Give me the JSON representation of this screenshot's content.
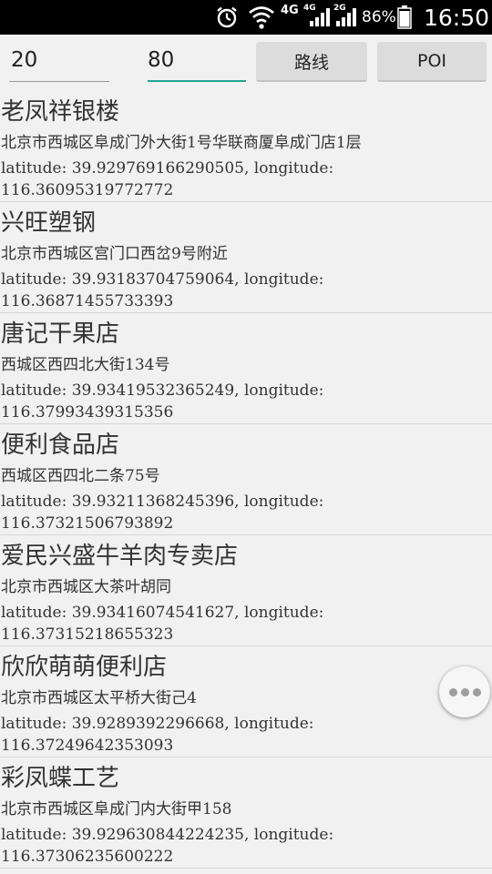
{
  "status_bar": {
    "network_4g": "4G",
    "network_4g_small": "4G",
    "network_2g_small": "2G",
    "battery_percent": "86%",
    "time": "16:50",
    "icons": [
      "alarm-icon",
      "wifi-icon",
      "signal-icon",
      "battery-icon"
    ]
  },
  "toolbar": {
    "input_1_value": "20",
    "input_2_value": "80",
    "route_button_label": "路线",
    "poi_button_label": "POI",
    "accent_color": "#24a396"
  },
  "poi_list": [
    {
      "name": "老凤祥银楼",
      "address": "北京市西城区阜成门外大街1号华联商厦阜成门店1层",
      "coords": "latitude: 39.929769166290505, longitude: 116.36095319772772"
    },
    {
      "name": "兴旺塑钢",
      "address": "北京市西城区宫门口西岔9号附近",
      "coords": "latitude: 39.93183704759064, longitude: 116.36871455733393"
    },
    {
      "name": "唐记干果店",
      "address": "西城区西四北大街134号",
      "coords": "latitude: 39.93419532365249, longitude: 116.37993439315356"
    },
    {
      "name": "便利食品店",
      "address": "西城区西四北二条75号",
      "coords": "latitude: 39.93211368245396, longitude: 116.37321506793892"
    },
    {
      "name": "爱民兴盛牛羊肉专卖店",
      "address": "北京市西城区大茶叶胡同",
      "coords": "latitude: 39.93416074541627, longitude: 116.37315218655323"
    },
    {
      "name": "欣欣萌萌便利店",
      "address": "北京市西城区太平桥大街己4",
      "coords": "latitude: 39.9289392296668, longitude: 116.37249642353093"
    },
    {
      "name": "彩凤蝶工艺",
      "address": "北京市西城区阜成门内大街甲158",
      "coords": "latitude: 39.929630844224235, longitude: 116.37306235600222"
    }
  ],
  "floating_button": {
    "icon": "more-icon"
  }
}
